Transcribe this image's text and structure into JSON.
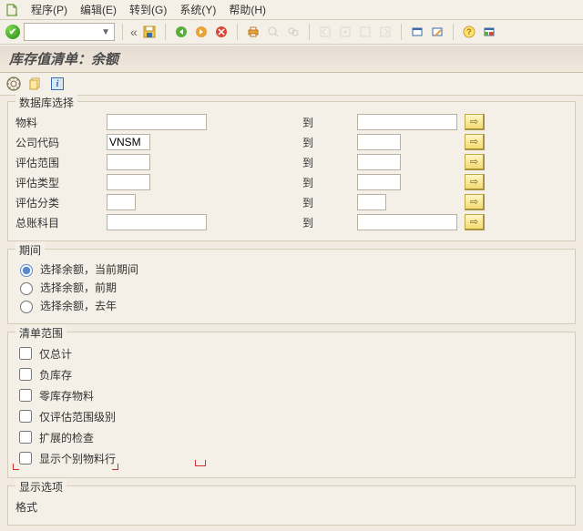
{
  "menu": {
    "program": "程序(P)",
    "edit": "编辑(E)",
    "goto": "转到(G)",
    "system": "系统(Y)",
    "help": "帮助(H)"
  },
  "toolbar": {
    "back_glyph": "«"
  },
  "title": "库存值清单：余额",
  "groups": {
    "db": {
      "legend": "数据库选择",
      "rows": {
        "material": {
          "label": "物料",
          "to": "到"
        },
        "company": {
          "label": "公司代码",
          "from_value": "VNSM",
          "to": "到"
        },
        "valarea": {
          "label": "评估范围",
          "to": "到"
        },
        "valtype": {
          "label": "评估类型",
          "to": "到"
        },
        "valclass": {
          "label": "评估分类",
          "to": "到"
        },
        "gl": {
          "label": "总账科目",
          "to": "到"
        }
      }
    },
    "period": {
      "legend": "期间",
      "opt_current": "选择余额，当前期间",
      "opt_prev": "选择余额，前期",
      "opt_lastyear": "选择余额，去年"
    },
    "scope": {
      "legend": "清单范围",
      "only_total": "仅总计",
      "neg_stock": "负库存",
      "zero_mat": "零库存物料",
      "only_level": "仅评估范围级别",
      "ext_check": "扩展的检查",
      "show_rows": "显示个别物料行"
    },
    "display": {
      "legend": "显示选项",
      "format": "格式"
    }
  }
}
